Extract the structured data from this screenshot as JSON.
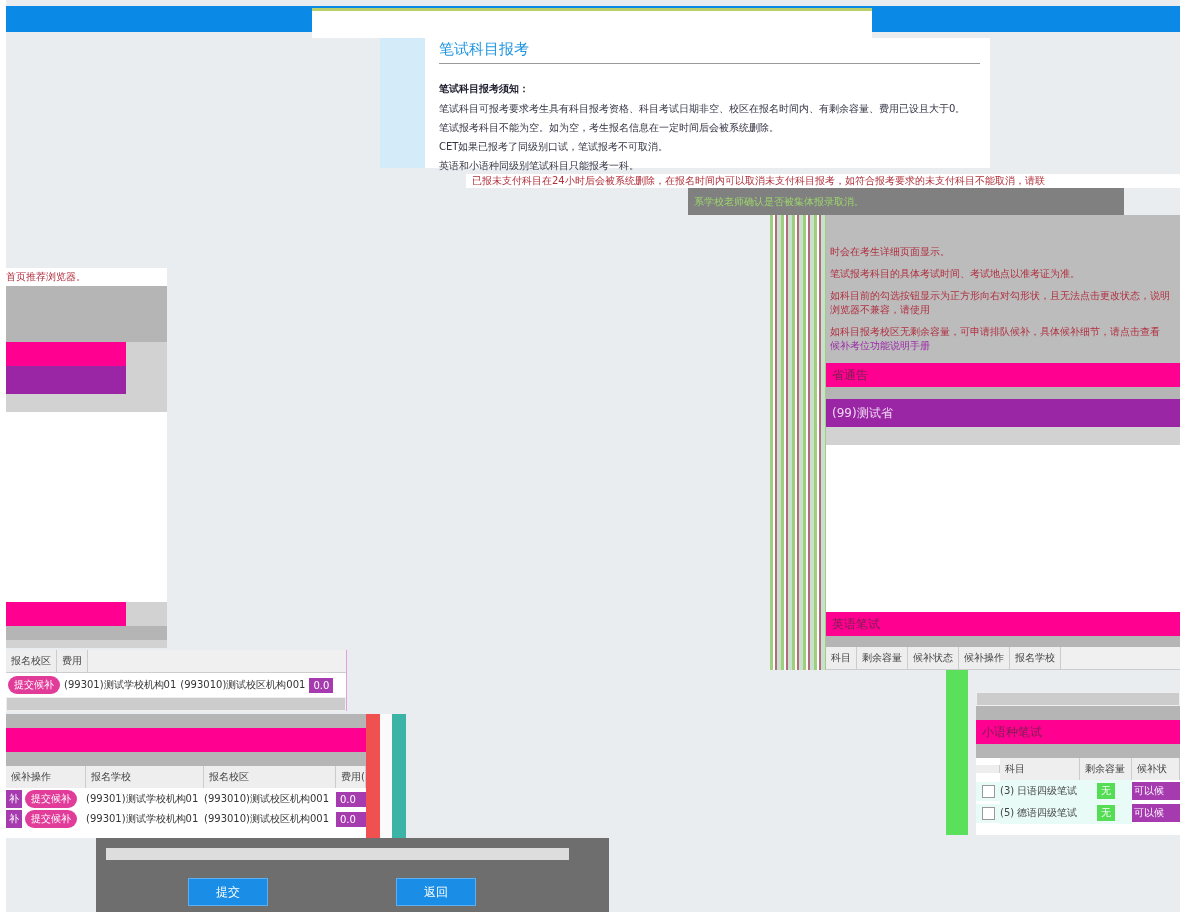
{
  "page_title": "笔试科目报考",
  "notice": {
    "heading": "笔试科目报考须知：",
    "lines": [
      "笔试科目可报考要求考生具有科目报考资格、科目考试日期非空、校区在报名时间内、有剩余容量、费用已设且大于0。",
      "笔试报考科目不能为空。如为空，考生报名信息在一定时间后会被系统删除。",
      "CET如果已报考了同级别口试，笔试报考不可取消。",
      "英语和小语种同级别笔试科目只能报考一科。"
    ]
  },
  "warning": "已报未支付科目在24小时后会被系统删除，在报名时间内可以取消未支付科目报考，如符合报考要求的未支付科目不能取消，请联",
  "warning_continued": "系学校老师确认是否被集体报录取消。",
  "right_panel": {
    "notes": [
      "时会在考生详细页面显示。",
      "笔试报考科目的具体考试时间、考试地点以准考证为准。",
      "如科目前的勾选按钮显示为正方形向右对勾形状，且无法点击更改状态，说明浏览器不兼容，请使用"
    ],
    "last_note": "如科目报考校区无剩余容量，可申请排队候补，具体候补细节，请点击查看",
    "link": "候补考位功能说明手册",
    "province_notice": "省通告",
    "province": "(99)测试省",
    "section": "英语笔试",
    "columns": [
      "科目",
      "剩余容量",
      "候补状态",
      "候补操作",
      "报名学校"
    ]
  },
  "left_panel": {
    "note": "首页推荐浏览器。",
    "columns": [
      "报名校区",
      "费用"
    ],
    "row": {
      "action": "提交候补",
      "school": "(99301)测试学校机构01",
      "campus": "(993010)测试校区机构001",
      "fee": "0.0"
    }
  },
  "lower_left": {
    "columns": [
      "候补操作",
      "报名学校",
      "报名校区",
      "费用("
    ],
    "rows": [
      {
        "status": "补",
        "action": "提交候补",
        "school": "(99301)测试学校机构01",
        "campus": "(993010)测试校区机构001",
        "fee": "0.0"
      },
      {
        "status": "补",
        "action": "提交候补",
        "school": "(99301)测试学校机构01",
        "campus": "(993010)测试校区机构001",
        "fee": "0.0"
      }
    ]
  },
  "lower_right": {
    "section": "小语种笔试",
    "columns": [
      "科目",
      "剩余容量",
      "候补状"
    ],
    "rows": [
      {
        "checked": false,
        "subject": "(3) 日语四级笔试",
        "capacity": "无",
        "status": "可以候"
      },
      {
        "checked": false,
        "subject": "(5) 德语四级笔试",
        "capacity": "无",
        "status": "可以候"
      }
    ]
  },
  "buttons": [
    "提交",
    "返回"
  ]
}
